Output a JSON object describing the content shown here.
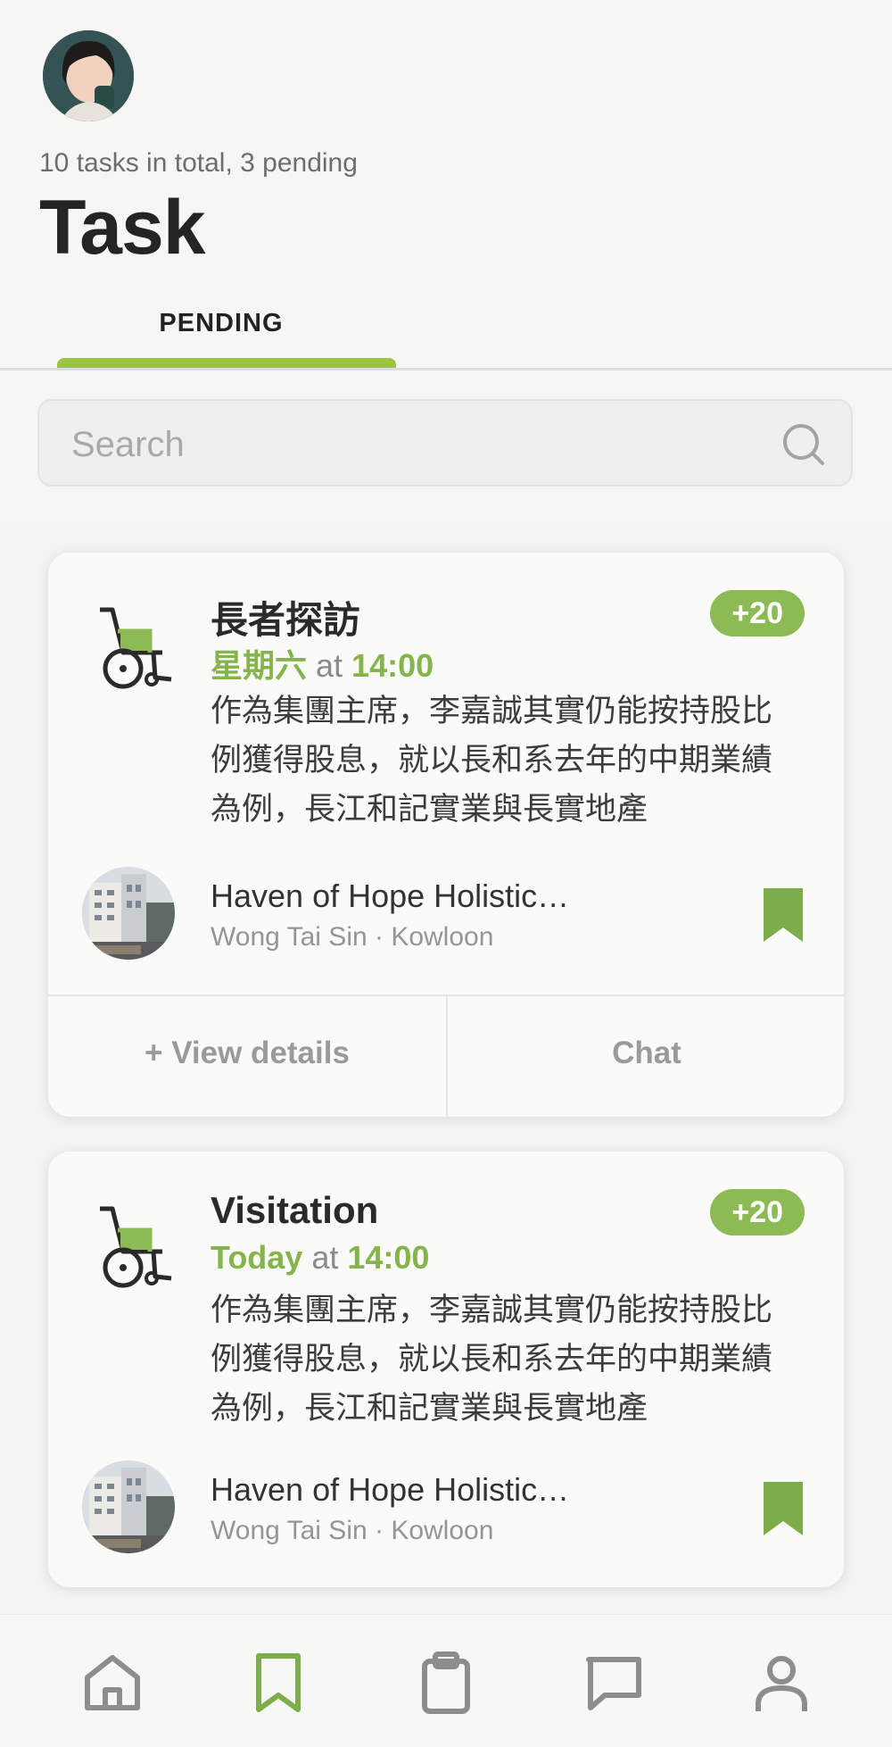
{
  "header": {
    "subtitle": "10 tasks in total, 3 pending",
    "title": "Task"
  },
  "tabs": [
    {
      "label": "PENDING",
      "active": true
    }
  ],
  "search": {
    "placeholder": "Search"
  },
  "accent_color": "#8cba54",
  "tasks": [
    {
      "icon": "wheelchair-icon",
      "title": "長者探訪",
      "points": "+20",
      "day": "星期六",
      "at": "at",
      "time": "14:00",
      "description": "作為集團主席，李嘉誠其實仍能按持股比例獲得股息，就以長和系去年的中期業績為例，長江和記實業與長實地產",
      "place_name": "Haven of Hope Holistic…",
      "place_area": "Wong Tai Sin · Kowloon",
      "view_details": "+ View details",
      "chat": "Chat"
    },
    {
      "icon": "wheelchair-icon",
      "title": "Visitation",
      "points": "+20",
      "day": "Today",
      "at": "at",
      "time": "14:00",
      "description": "作為集團主席，李嘉誠其實仍能按持股比例獲得股息，就以長和系去年的中期業績為例，長江和記實業與長實地產",
      "place_name": "Haven of Hope Holistic…",
      "place_area": "Wong Tai Sin · Kowloon"
    }
  ],
  "nav": [
    "home-icon",
    "bookmark-icon",
    "clipboard-icon",
    "chat-icon",
    "profile-icon"
  ]
}
